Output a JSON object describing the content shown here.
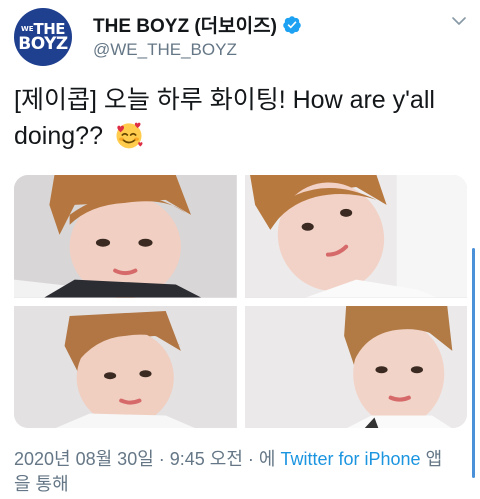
{
  "author": {
    "display_name": "THE BOYZ (더보이즈)",
    "handle": "@WE_THE_BOYZ",
    "avatar_text_line1": "THE",
    "avatar_text_prefix": "WE",
    "avatar_text_line2": "BOYZ",
    "verified": true
  },
  "tweet": {
    "text": "[제이콥] 오늘 하루 화이팅! How are y'all doing??",
    "emoji": "smiling-face-with-hearts"
  },
  "photos": [
    {
      "name": "photo-1",
      "alt": "selfie photo 1"
    },
    {
      "name": "photo-2",
      "alt": "selfie photo 2"
    },
    {
      "name": "photo-3",
      "alt": "selfie photo 3"
    },
    {
      "name": "photo-4",
      "alt": "selfie photo 4"
    }
  ],
  "meta": {
    "timestamp": "2020년 08월 30일 · 9:45 오전 · 에",
    "source_link": "Twitter for iPhone",
    "source_suffix": "앱을 통해"
  },
  "colors": {
    "text": "#14171a",
    "secondary": "#657786",
    "link": "#1b95e0",
    "verified": "#1da1f2",
    "avatar_bg": "#1f3f8f"
  }
}
